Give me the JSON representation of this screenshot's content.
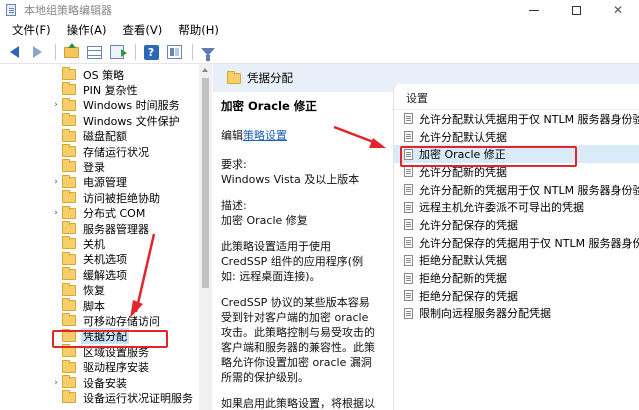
{
  "window": {
    "title": "本地组策略编辑器"
  },
  "menu": [
    "文件(F)",
    "操作(A)",
    "查看(V)",
    "帮助(H)"
  ],
  "tree": {
    "items": [
      {
        "label": "OS 策略",
        "chevron": false,
        "selected": false
      },
      {
        "label": "PIN 复杂性",
        "chevron": false,
        "selected": false
      },
      {
        "label": "Windows 时间服务",
        "chevron": true,
        "selected": false
      },
      {
        "label": "Windows 文件保护",
        "chevron": false,
        "selected": false
      },
      {
        "label": "磁盘配额",
        "chevron": false,
        "selected": false
      },
      {
        "label": "存储运行状况",
        "chevron": false,
        "selected": false
      },
      {
        "label": "登录",
        "chevron": false,
        "selected": false
      },
      {
        "label": "电源管理",
        "chevron": true,
        "selected": false
      },
      {
        "label": "访问被拒绝协助",
        "chevron": false,
        "selected": false
      },
      {
        "label": "分布式 COM",
        "chevron": true,
        "selected": false
      },
      {
        "label": "服务器管理器",
        "chevron": false,
        "selected": false
      },
      {
        "label": "关机",
        "chevron": false,
        "selected": false
      },
      {
        "label": "关机选项",
        "chevron": false,
        "selected": false
      },
      {
        "label": "缓解选项",
        "chevron": false,
        "selected": false
      },
      {
        "label": "恢复",
        "chevron": false,
        "selected": false
      },
      {
        "label": "脚本",
        "chevron": false,
        "selected": false
      },
      {
        "label": "可移动存储访问",
        "chevron": false,
        "selected": false
      },
      {
        "label": "凭据分配",
        "chevron": false,
        "selected": true
      },
      {
        "label": "区域设置服务",
        "chevron": false,
        "selected": false
      },
      {
        "label": "驱动程序安装",
        "chevron": false,
        "selected": false
      },
      {
        "label": "设备安装",
        "chevron": true,
        "selected": false
      },
      {
        "label": "设备运行状况证明服务",
        "chevron": false,
        "selected": false
      }
    ]
  },
  "detail": {
    "header": "凭据分配",
    "policy_title": "加密 Oracle 修正",
    "edit_prefix": "编辑",
    "edit_link": "策略设置",
    "requirements_label": "要求:",
    "requirements_text": "Windows Vista 及以上版本",
    "description_label": "描述:",
    "description_text": "加密 Oracle 修复",
    "para1": "此策略设置适用于使用 CredSSP 组件的应用程序(例如: 远程桌面连接)。",
    "para2": "CredSSP 协议的某些版本容易受到针对客户端的加密 oracle 攻击。此策略控制与易受攻击的客户端和服务器的兼容性。此策略允许你设置加密 oracle 漏洞所需的保护级别。",
    "para3": "如果启用此策略设置，将根据以下"
  },
  "settings": {
    "column_header": "设置",
    "items": [
      "允许分配默认凭据用于仅 NTLM 服务器身份验证",
      "允许分配默认凭据",
      "加密 Oracle 修正",
      "允许分配新的凭据",
      "允许分配新的凭据用于仅 NTLM 服务器身份验证",
      "远程主机允许委派不可导出的凭据",
      "允许分配保存的凭据",
      "允许分配保存的凭据用于仅 NTLM 服务器身份验证",
      "拒绝分配默认凭据",
      "拒绝分配新的凭据",
      "拒绝分配保存的凭据",
      "限制向远程服务器分配凭据"
    ],
    "highlighted_index": 2
  },
  "annotation_color": "#e0262b"
}
